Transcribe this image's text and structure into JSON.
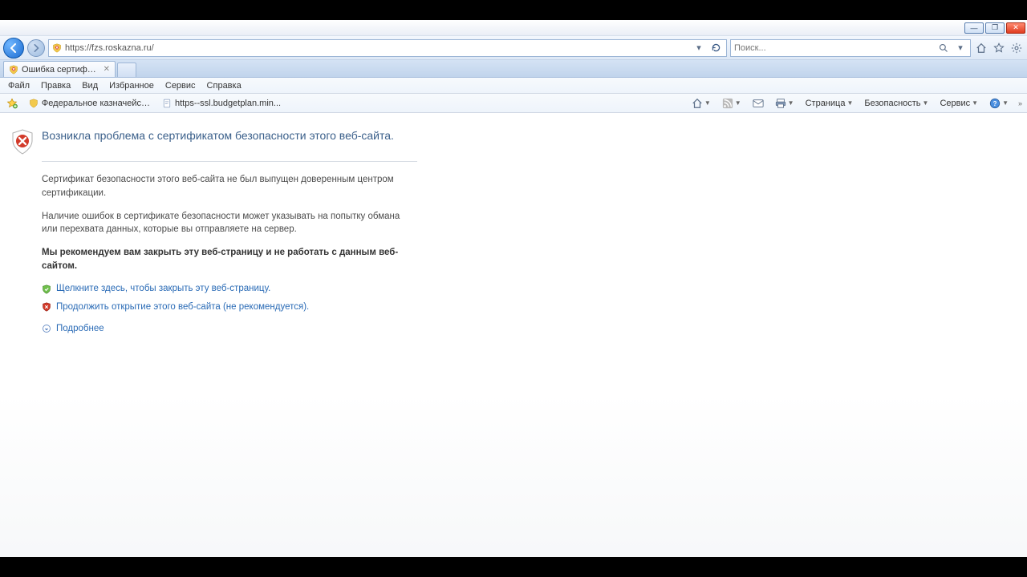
{
  "window_controls": {
    "minimize": "—",
    "maximize": "❐",
    "close": "✕"
  },
  "nav": {
    "url": "https://fzs.roskazna.ru/",
    "search_placeholder": "Поиск..."
  },
  "tab": {
    "title": "Ошибка сертификата: пе..."
  },
  "menu": {
    "file": "Файл",
    "edit": "Правка",
    "view": "Вид",
    "favorites": "Избранное",
    "tools": "Сервис",
    "help": "Справка"
  },
  "favorites": [
    {
      "label": "Федеральное казначейст..."
    },
    {
      "label": "https--ssl.budgetplan.min..."
    }
  ],
  "cmd": {
    "page": "Страница",
    "security": "Безопасность",
    "service": "Сервис"
  },
  "cert_error": {
    "heading": "Возникла проблема с сертификатом безопасности этого веб-сайта.",
    "line1": "Сертификат безопасности этого веб-сайта не был выпущен доверенным центром сертификации.",
    "line2": "Наличие ошибок в сертификате безопасности может указывать на попытку обмана или перехвата данных, которые вы отправляете на сервер.",
    "recommend": "Мы рекомендуем вам закрыть эту веб-страницу и не работать с данным веб-сайтом.",
    "close_link": "Щелкните здесь, чтобы закрыть эту веб-страницу.",
    "continue_link": "Продолжить открытие этого веб-сайта (не рекомендуется).",
    "more_info": "Подробнее"
  }
}
